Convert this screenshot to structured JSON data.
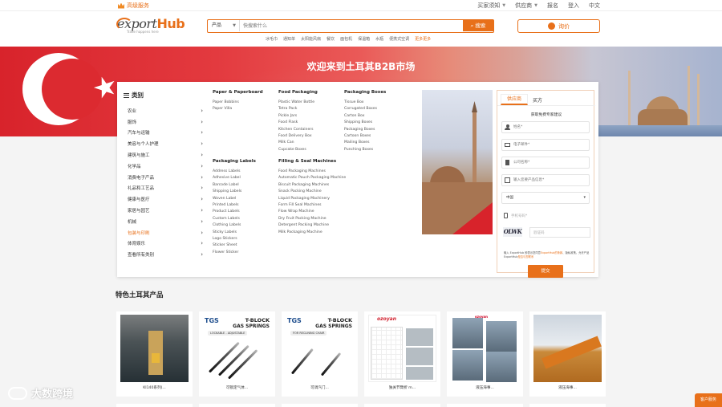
{
  "topbar": {
    "vip": "高级服务",
    "links": [
      {
        "label": "买家须知",
        "dropdown": true
      },
      {
        "label": "供应商",
        "dropdown": true
      },
      {
        "label": "报名",
        "dropdown": false
      },
      {
        "label": "登入",
        "dropdown": false
      },
      {
        "label": "中文",
        "dropdown": false
      }
    ]
  },
  "header": {
    "logo_main_prefix": "e",
    "logo_main_x": "xport",
    "logo_main_brand": "Hub",
    "logo_tag": "Trade happens here",
    "search": {
      "category": "产品",
      "placeholder": "快搜索什么",
      "button": "搜索"
    },
    "hot_searches": [
      "冰毛巾",
      "通知单",
      "太阳能风扇",
      "餐饮",
      "面包机",
      "保温箱",
      "水瓶",
      "便携式空调",
      "更多更多"
    ],
    "quote_button": "询价"
  },
  "banner": {
    "title": "欢迎来到土耳其B2B市场"
  },
  "categories": {
    "header": "类别",
    "items": [
      {
        "label": "农业",
        "active": false
      },
      {
        "label": "服饰",
        "active": false
      },
      {
        "label": "汽车与运输",
        "active": false
      },
      {
        "label": "美容与个人护理",
        "active": false
      },
      {
        "label": "建筑与施工",
        "active": false
      },
      {
        "label": "化学品",
        "active": false
      },
      {
        "label": "消费电子产品",
        "active": false
      },
      {
        "label": "礼品和工艺品",
        "active": false
      },
      {
        "label": "健康与医疗",
        "active": false
      },
      {
        "label": "家居与园艺",
        "active": false
      },
      {
        "label": "机械",
        "active": false
      },
      {
        "label": "包装与印刷",
        "active": true
      },
      {
        "label": "体育娱乐",
        "active": false
      },
      {
        "label": "查看所有类别",
        "active": false
      }
    ]
  },
  "submenu": {
    "paper": {
      "title": "Paper & Paperboard",
      "items": [
        "Paper Bobbins",
        "Paper Villa"
      ]
    },
    "labels": {
      "title": "Packaging Labels",
      "items": [
        "Address Labels",
        "Adhesive Label",
        "Barcode Label",
        "Shipping Labels",
        "Woven Label",
        "Printed Labels",
        "Product Labels",
        "Custom Labels",
        "Clothing Labels",
        "Sticky Labels",
        "Logo Stickers",
        "Sticker Sheet",
        "Flower Sticker"
      ]
    },
    "food": {
      "title": "Food Packaging",
      "items": [
        "Plastic Water Bottle",
        "Tetra Pack",
        "Pickle Jars",
        "Food Flask",
        "Kitchen Containers",
        "Food Delivery Box",
        "Milk Can",
        "Cupcake Boxes"
      ]
    },
    "filling": {
      "title": "Filling & Seal Machines",
      "items": [
        "Food Packaging Machines",
        "Automatic Pouch Packaging Machine",
        "Biscuit Packaging Machines",
        "Snack Packing Machine",
        "Liquid Packaging Machinery",
        "Form Fill Seal Machines",
        "Flow Wrap Machine",
        "Dry Fruit Packing Machine",
        "Detergent Packing Machine",
        "Milk Packaging Machine"
      ]
    },
    "boxes": {
      "title": "Packaging Boxes",
      "items": [
        "Tissue Box",
        "Corrugated Boxes",
        "Carton Box",
        "Shipping Boxes",
        "Packaging Boxes",
        "Cartoon Boxes",
        "Mailing Boxes",
        "Punching Boxes"
      ]
    }
  },
  "form": {
    "tab_supplier": "供应商",
    "tab_buyer": "买方",
    "subtitle": "获取免费专家建议",
    "name_placeholder": "姓名*",
    "email_placeholder": "电子邮件*",
    "company_placeholder": "公司名称*",
    "product_placeholder": "输入您要产品信息*",
    "country": "中国",
    "phone_placeholder": "手机号码*",
    "captcha_text": "OLWK",
    "captcha_placeholder": "验证码",
    "terms_prefix": "输入 ExportHub 即表示您同意",
    "terms_link1": "ExportHub的条款",
    "terms_mid": "、隐私政策。允许产品 ExportHub",
    "terms_link2": "是否与您联系",
    "submit": "提交"
  },
  "featured": {
    "title": "特色土耳其产品",
    "products": [
      {
        "caption": "KI140系列(..."
      },
      {
        "caption": "可锁定气体..."
      },
      {
        "caption": "可调汽门..."
      },
      {
        "caption": "独关节臂折 m..."
      },
      {
        "caption": "液压海事..."
      },
      {
        "caption": "液压海事..."
      }
    ],
    "spring_brand": "TGS",
    "spring_t1": "T-BLOCK",
    "spring_t2": "GAS SPRINGS",
    "spring_tag_a": "LOCKABLE - ADJUSTABLE",
    "spring_tag_b": "FOR RECLINING CHAIR",
    "crane_brand": "ozoyan",
    "crane4_brand": "ozoyan"
  },
  "watermark": "大数跨境",
  "service_button": "客户服务"
}
